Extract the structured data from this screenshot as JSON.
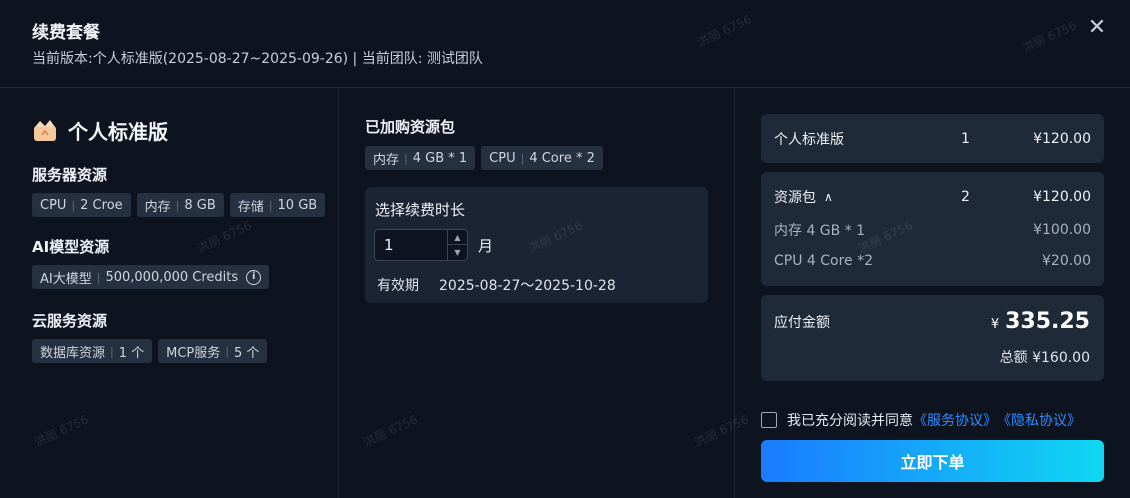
{
  "header": {
    "title": "续费套餐",
    "subtitle": "当前版本:个人标准版(2025-08-27~2025-09-26) | 当前团队: 测试团队",
    "close_icon": "close-icon"
  },
  "plan": {
    "name": "个人标准版",
    "icon": "crown-icon",
    "server": {
      "title": "服务器资源",
      "tags": [
        {
          "k": "CPU",
          "v": "2 Croe"
        },
        {
          "k": "内存",
          "v": "8 GB"
        },
        {
          "k": "存储",
          "v": "10 GB"
        }
      ]
    },
    "ai": {
      "title": "AI模型资源",
      "tags": [
        {
          "k": "AI大模型",
          "v": "500,000,000 Credits"
        }
      ],
      "info_icon": "info-icon"
    },
    "cloud": {
      "title": "云服务资源",
      "tags": [
        {
          "k": "数据库资源",
          "v": "1 个"
        },
        {
          "k": "MCP服务",
          "v": "5 个"
        }
      ]
    }
  },
  "addons": {
    "title": "已加购资源包",
    "tags": [
      {
        "k": "内存",
        "v": "4 GB * 1"
      },
      {
        "k": "CPU",
        "v": "4 Core * 2"
      }
    ]
  },
  "duration": {
    "title": "选择续费时长",
    "value": "1",
    "unit": "月",
    "valid_label": "有效期",
    "valid_value": "2025-08-27～2025-10-28"
  },
  "summary": {
    "plan_row": {
      "name": "个人标准版",
      "qty": "1",
      "price": "¥120.00"
    },
    "pack_row": {
      "name": "资源包",
      "qty": "2",
      "price": "¥120.00",
      "caret": "^"
    },
    "pack_items": [
      {
        "name": "内存 4 GB * 1",
        "price": "¥100.00"
      },
      {
        "name": "CPU 4 Core *2",
        "price": "¥20.00"
      }
    ],
    "pay_label": "应付金额",
    "pay_currency": "¥",
    "pay_amount": "335.25",
    "total_label": "总额 ¥160.00"
  },
  "agreement": {
    "text": "我已充分阅读并同意",
    "service_link": "《服务协议》",
    "privacy_link": "《隐私协议》"
  },
  "submit_label": "立即下单",
  "watermark": "洪丽 6756",
  "colors": {
    "accent": "#2f8cff",
    "gradient_start": "#1b7bff",
    "gradient_end": "#0fd7f3"
  }
}
